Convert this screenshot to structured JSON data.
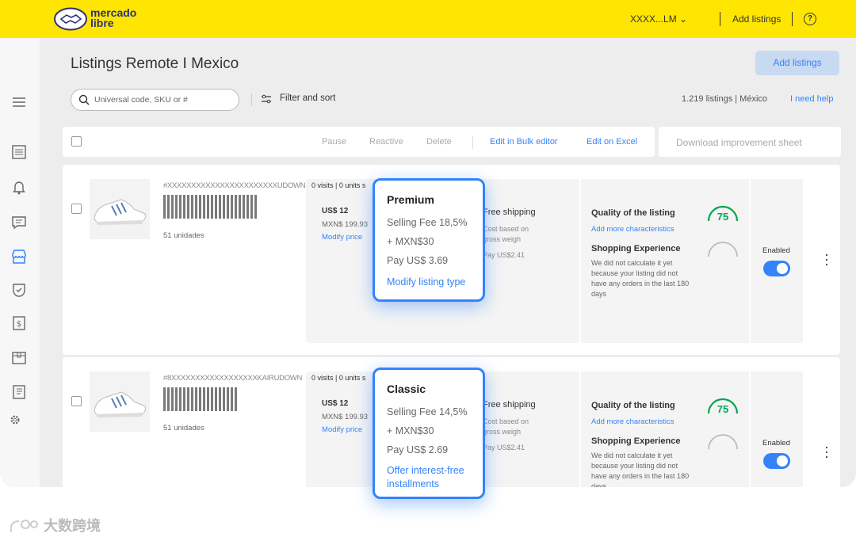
{
  "brand": {
    "line1": "mercado",
    "line2": "libre"
  },
  "topbar": {
    "user": "XXXX...LM",
    "add_listings": "Add listings",
    "help": "?"
  },
  "page": {
    "title": "Listings Remote I Mexico",
    "add_button": "Add listings",
    "search_placeholder": "Universal code, SKU or #",
    "filter": "Filter and sort",
    "count": "1.219 listings | México",
    "help_link": "I need help"
  },
  "toolbar": {
    "pause": "Pause",
    "reactive": "Reactive",
    "delete": "Delete",
    "bulk": "Edit in Bulk editor",
    "excel": "Edit on Excel",
    "download": "Download improvement sheet"
  },
  "listings": [
    {
      "sku": "#XXXXXXXXXXXXXXXXXXXXXXXUDOWN",
      "units": "51 unidades",
      "stats": "0 visits | 0 units s",
      "price": "US$ 12",
      "price_mxn": "MXN$ 199.93",
      "modify_price": "Modify price",
      "shipping": "Free shipping",
      "ship_note1": "Cost based on",
      "ship_note2": "gross weigh",
      "ship_pay": "Pay US$2.41",
      "quality_title": "Quality of the listing",
      "quality_link": "Add more characteristics",
      "score": "75",
      "exp_title": "Shopping Experience",
      "exp_desc": "We did not calculate it yet because your listing did not have any orders in the last 180 days",
      "enabled": "Enabled"
    },
    {
      "sku": "#8XXXXXXXXXXXXXXXXXXKAIRUDOWN",
      "units": "51 unidades",
      "stats": "0 visits | 0 units s",
      "price": "US$ 12",
      "price_mxn": "MXN$ 199.93",
      "modify_price": "Modify price",
      "shipping": "Free shipping",
      "ship_note1": "Cost based on",
      "ship_note2": "gross weigh",
      "ship_pay": "Pay US$2.41",
      "quality_title": "Quality of the listing",
      "quality_link": "Add more characteristics",
      "score": "75",
      "exp_title": "Shopping Experience",
      "exp_desc": "We did not calculate it yet because your listing did not have any orders in the last 180 days",
      "enabled": "Enabled"
    }
  ],
  "popups": [
    {
      "title": "Premium",
      "fee": "Selling Fee 18,5%",
      "plus": "+ MXN$30",
      "pay": "Pay US$ 3.69",
      "link": "Modify listing type"
    },
    {
      "title": "Classic",
      "fee": "Selling Fee 14,5%",
      "plus": "+ MXN$30",
      "pay": "Pay US$ 2.69",
      "link": "Offer interest-free installments"
    }
  ],
  "watermark": "大数跨境",
  "colors": {
    "yellow": "#ffe600",
    "accent": "#3483fa",
    "gauge": "#00a650"
  }
}
